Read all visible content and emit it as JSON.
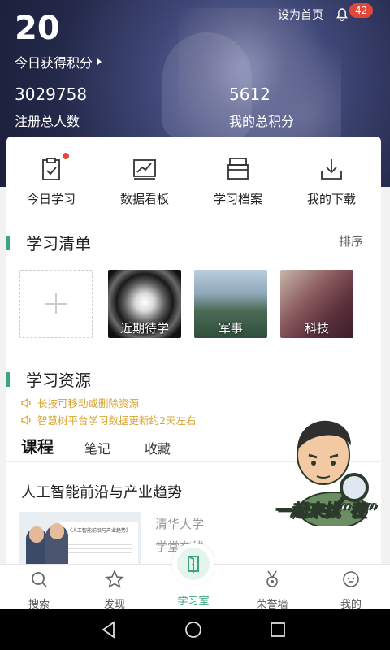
{
  "header": {
    "today_score": "20",
    "today_label": "今日获得积分",
    "set_home": "设为首页",
    "notification_count": "42",
    "registered_total": "3029758",
    "registered_label": "注册总人数",
    "my_total": "5612",
    "my_total_label": "我的总积分"
  },
  "quick_actions": [
    {
      "label": "今日学习",
      "icon": "clipboard-check-icon"
    },
    {
      "label": "数据看板",
      "icon": "chart-board-icon"
    },
    {
      "label": "学习档案",
      "icon": "archive-icon"
    },
    {
      "label": "我的下载",
      "icon": "download-tray-icon"
    }
  ],
  "study_list": {
    "title": "学习清单",
    "sort_label": "排序",
    "items": [
      {
        "label": "近期待学"
      },
      {
        "label": "军事"
      },
      {
        "label": "科技"
      }
    ]
  },
  "resources": {
    "title": "学习资源",
    "notices": [
      "长按可移动或删除资源",
      "智慧树平台学习数据更新约2天左右"
    ],
    "tabs": [
      "课程",
      "笔记",
      "收藏"
    ],
    "course": {
      "title": "人工智能前沿与产业趋势",
      "provider_line1": "清华大学",
      "provider_line2": "学堂在线",
      "thumb_caption": "《人工智能前沿与产业趋势》"
    }
  },
  "mascot": {
    "slogan": "一起来找“茬”"
  },
  "bottom_nav": [
    {
      "label": "搜索",
      "icon": "search-icon"
    },
    {
      "label": "发现",
      "icon": "star-icon"
    },
    {
      "label": "学习室",
      "icon": "door-icon"
    },
    {
      "label": "荣誉墙",
      "icon": "medal-icon"
    },
    {
      "label": "我的",
      "icon": "profile-icon"
    }
  ],
  "colors": {
    "accent": "#3aa67c",
    "badge": "#e2473b",
    "notice": "#d9a32a"
  }
}
